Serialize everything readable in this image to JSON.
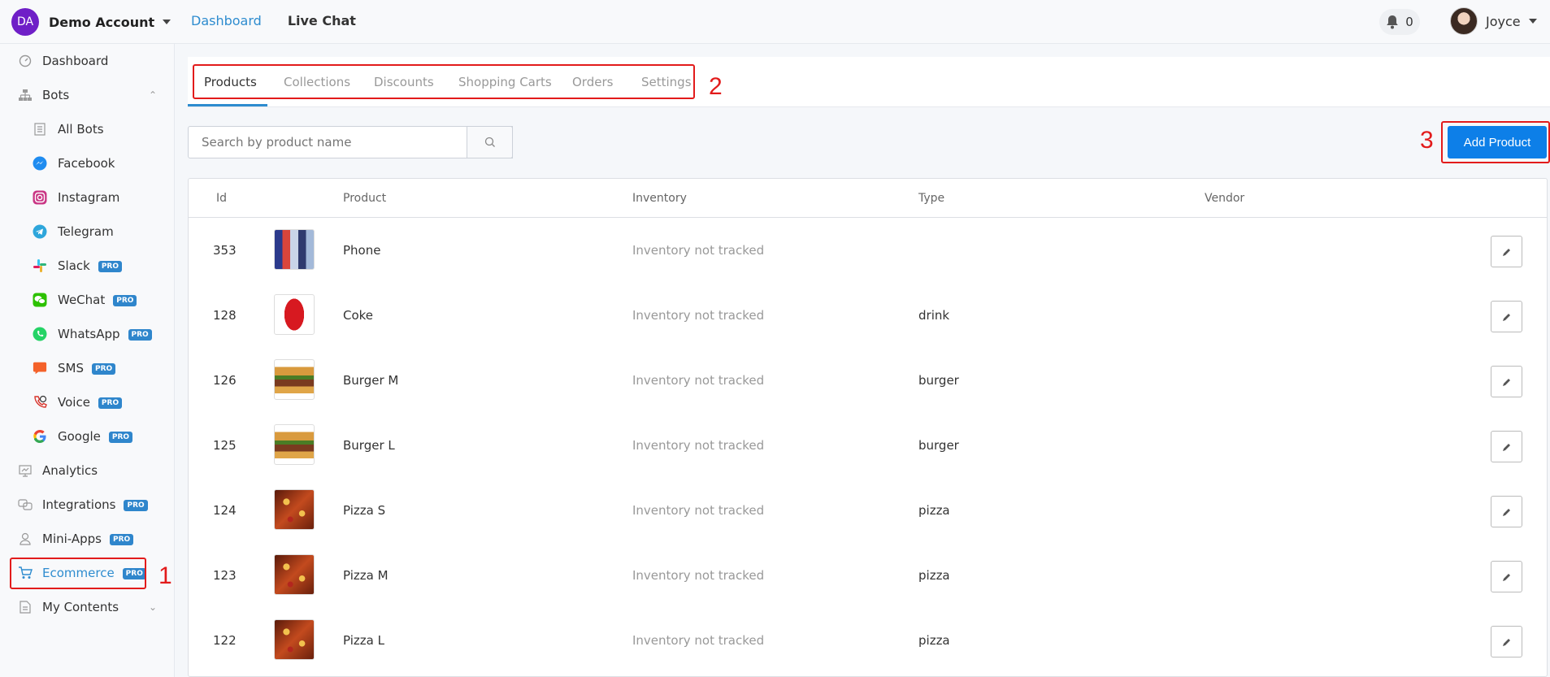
{
  "header": {
    "account_initials": "DA",
    "account_name": "Demo Account",
    "nav": [
      {
        "label": "Dashboard",
        "active": true
      },
      {
        "label": "Live Chat",
        "active": false
      }
    ],
    "notification_count": "0",
    "user_name": "Joyce"
  },
  "sidebar": {
    "items": [
      {
        "label": "Dashboard",
        "icon": "dashboard-icon"
      },
      {
        "label": "Bots",
        "icon": "sitemap-icon",
        "expanded": true
      },
      {
        "label": "All Bots",
        "icon": "list-icon",
        "sub": true
      },
      {
        "label": "Facebook",
        "icon": "messenger-icon",
        "sub": true
      },
      {
        "label": "Instagram",
        "icon": "instagram-icon",
        "sub": true
      },
      {
        "label": "Telegram",
        "icon": "telegram-icon",
        "sub": true
      },
      {
        "label": "Slack",
        "icon": "slack-icon",
        "sub": true,
        "pro": "PRO"
      },
      {
        "label": "WeChat",
        "icon": "wechat-icon",
        "sub": true,
        "pro": "PRO"
      },
      {
        "label": "WhatsApp",
        "icon": "whatsapp-icon",
        "sub": true,
        "pro": "PRO"
      },
      {
        "label": "SMS",
        "icon": "sms-icon",
        "sub": true,
        "pro": "PRO"
      },
      {
        "label": "Voice",
        "icon": "phone-icon",
        "sub": true,
        "pro": "PRO"
      },
      {
        "label": "Google",
        "icon": "google-icon",
        "sub": true,
        "pro": "PRO"
      },
      {
        "label": "Analytics",
        "icon": "analytics-icon"
      },
      {
        "label": "Integrations",
        "icon": "integrations-icon",
        "pro": "PRO"
      },
      {
        "label": "Mini-Apps",
        "icon": "user-icon",
        "pro": "PRO"
      },
      {
        "label": "Ecommerce",
        "icon": "cart-icon",
        "pro": "PRO",
        "active": true
      },
      {
        "label": "My Contents",
        "icon": "document-icon"
      }
    ]
  },
  "tabs": [
    {
      "label": "Products",
      "active": true
    },
    {
      "label": "Collections"
    },
    {
      "label": "Discounts"
    },
    {
      "label": "Shopping Carts"
    },
    {
      "label": "Orders"
    },
    {
      "label": "Settings"
    }
  ],
  "search": {
    "placeholder": "Search by product name"
  },
  "add_button": "Add Product",
  "annotations": [
    "1",
    "2",
    "3"
  ],
  "table": {
    "columns": [
      "Id",
      "Product",
      "Inventory",
      "Type",
      "Vendor"
    ],
    "rows": [
      {
        "id": "353",
        "product": "Phone",
        "inventory": "Inventory not tracked",
        "type": "",
        "vendor": "",
        "thumb": "phone"
      },
      {
        "id": "128",
        "product": "Coke",
        "inventory": "Inventory not tracked",
        "type": "drink",
        "vendor": "",
        "thumb": "coke"
      },
      {
        "id": "126",
        "product": "Burger M",
        "inventory": "Inventory not tracked",
        "type": "burger",
        "vendor": "",
        "thumb": "burger"
      },
      {
        "id": "125",
        "product": "Burger L",
        "inventory": "Inventory not tracked",
        "type": "burger",
        "vendor": "",
        "thumb": "burger"
      },
      {
        "id": "124",
        "product": "Pizza S",
        "inventory": "Inventory not tracked",
        "type": "pizza",
        "vendor": "",
        "thumb": "pizza"
      },
      {
        "id": "123",
        "product": "Pizza M",
        "inventory": "Inventory not tracked",
        "type": "pizza",
        "vendor": "",
        "thumb": "pizza"
      },
      {
        "id": "122",
        "product": "Pizza L",
        "inventory": "Inventory not tracked",
        "type": "pizza",
        "vendor": "",
        "thumb": "pizza"
      }
    ]
  },
  "colors": {
    "accent": "#2e8ccf",
    "primary_button": "#0d7fe8",
    "annotation": "#e21b1b",
    "pro_badge": "#2f86cc"
  }
}
